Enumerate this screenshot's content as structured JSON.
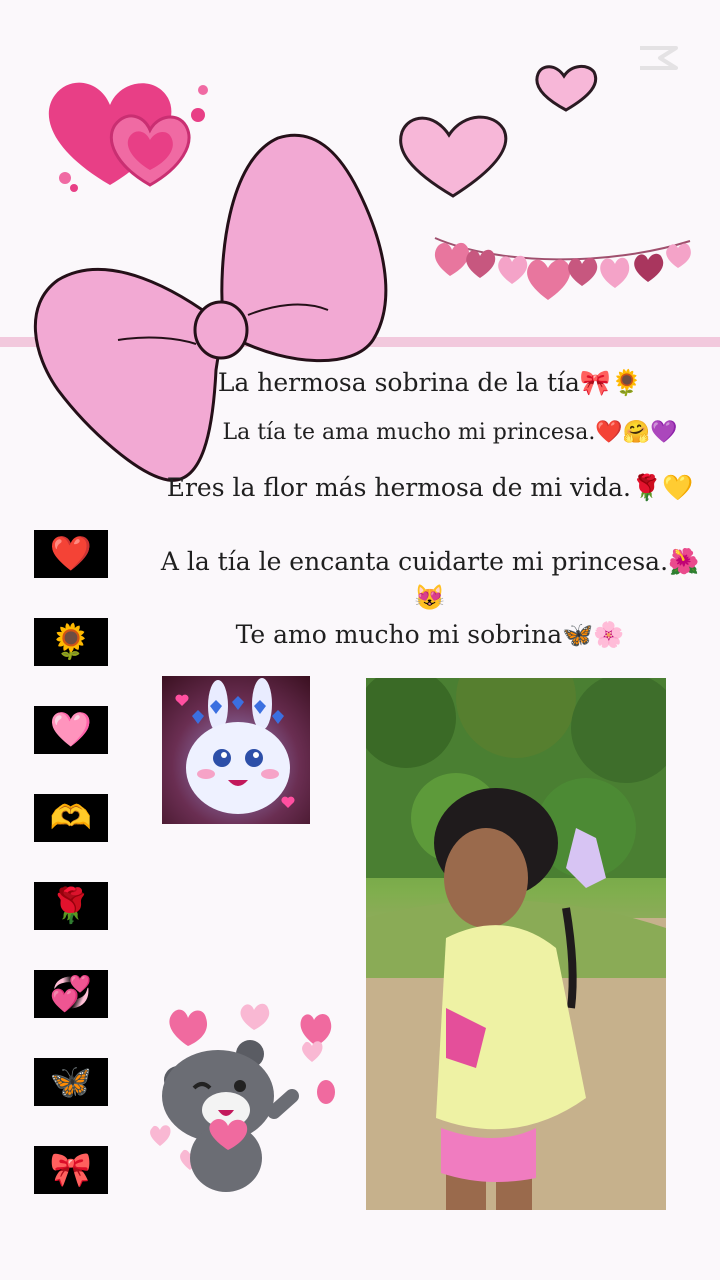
{
  "message_lines": [
    "La hermosa sobrina de la tía🎀🌻",
    "La tía te ama mucho mi princesa.❤️🤗💜",
    "Eres la flor más hermosa de mi vida.🌹💛",
    "A la tía le encanta cuidarte mi princesa.🌺😻",
    "Te amo mucho mi sobrina🦋🌸"
  ],
  "side_emojis": [
    "❤️",
    "🌻",
    "🩷",
    "🫶",
    "🌹",
    "💞",
    "🦋",
    "🎀"
  ],
  "icons": {
    "bow": "pink-bow-icon",
    "hearts_cluster": "hearts-cluster-icon",
    "heart_garland": "heart-garland-icon",
    "bear": "bear-sticker-icon",
    "bunny": "bunny-sticker-icon",
    "watermark": "capcut-logo-icon"
  },
  "colors": {
    "background": "#fbf8fb",
    "bow_pink": "#f2a9d3",
    "heart_pink": "#f7b7d8",
    "stripe": "#f2c9dd",
    "tile_bg": "#000000"
  }
}
